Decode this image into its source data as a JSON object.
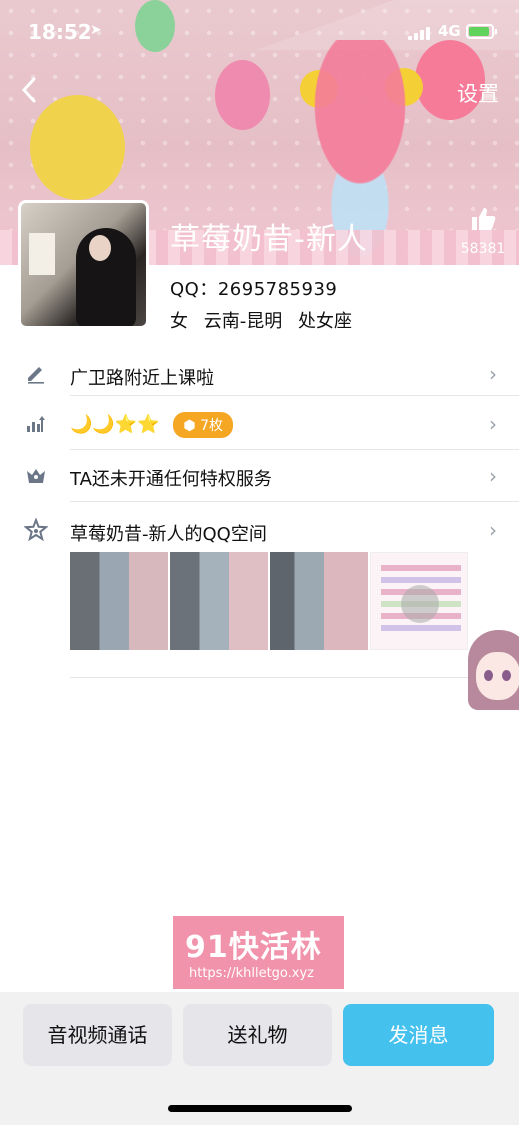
{
  "status_bar": {
    "time": "18:52",
    "network": "4G"
  },
  "header": {
    "settings_label": "设置"
  },
  "profile": {
    "name": "草莓奶昔-新人",
    "likes": "58381",
    "qq": "QQ：2695785939",
    "gender": "女",
    "location": "云南-昆明",
    "zodiac": "处女座"
  },
  "rows": {
    "signature": "广卫路附近上课啦",
    "level_badge": "7枚",
    "privilege": "TA还未开通任何特权服务",
    "qzone": "草莓奶昔-新人的QQ空间"
  },
  "watermark": {
    "title": "91快活林",
    "url": "https://khlletgo.xyz"
  },
  "actions": {
    "call": "音视频通话",
    "gift": "送礼物",
    "message": "发消息"
  },
  "colors": {
    "accent": "#45c1ee",
    "badge": "#f5a623"
  }
}
